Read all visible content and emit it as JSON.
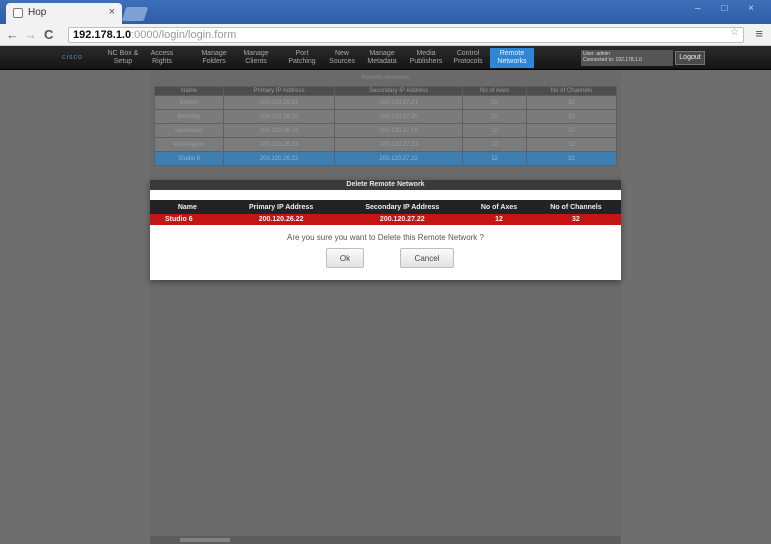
{
  "browser": {
    "tab_title": "Hop",
    "tab_close": "×",
    "window_buttons": "– □ ×",
    "back": "←",
    "forward": "→",
    "reload": "C",
    "url_host": "192.178.1.0",
    "url_path": ":0000/login/login.form",
    "menu_glyph": "≡",
    "bookmark_glyph": "☆"
  },
  "appnav": {
    "logo": "cisco",
    "items": [
      {
        "label": "NC Box &\nSetup"
      },
      {
        "label": "Access\nRights"
      },
      {
        "label": "Manage\nFolders"
      },
      {
        "label": "Manage\nClients"
      },
      {
        "label": "Port\nPatching"
      },
      {
        "label": "New\nSources"
      },
      {
        "label": "Manage\nMetadata"
      },
      {
        "label": "Media\nPublishers"
      },
      {
        "label": "Control\nProtocols"
      },
      {
        "label": "Remote\nNetworks"
      }
    ],
    "active_index": 9,
    "user_info": "User: admin\nConnected to: 192.178.1.0",
    "logout_label": "Logout"
  },
  "background": {
    "title": "Remote Networks",
    "columns": [
      "Name",
      "Primary IP Address",
      "Secondary IP Address",
      "No of Axes",
      "No of Channels"
    ],
    "rows": [
      [
        "Boston",
        "200.120.26.21",
        "200.120.27.21",
        "12",
        "32"
      ],
      [
        "Berkeley",
        "200.120.26.20",
        "200.120.27.20",
        "12",
        "32"
      ],
      [
        "Vancouver",
        "200.120.26.19",
        "200.120.27.19",
        "12",
        "32"
      ],
      [
        "Washington",
        "200.120.26.23",
        "200.120.27.23",
        "12",
        "32"
      ],
      [
        "Studio 6",
        "200.120.26.22",
        "200.120.27.22",
        "12",
        "32"
      ]
    ]
  },
  "dialog": {
    "title": "Delete Remote Network",
    "columns": [
      "Name",
      "Primary IP Address",
      "Secondary IP Address",
      "No of Axes",
      "No of Channels"
    ],
    "row": [
      "Studio 6",
      "200.120.26.22",
      "200.120.27.22",
      "12",
      "32"
    ],
    "question": "Are you sure you want to Delete this Remote Network ?",
    "ok_label": "Ok",
    "cancel_label": "Cancel"
  },
  "colors": {
    "accent": "#2d86d6",
    "danger_row": "#c41414",
    "dialog_header": "#232323"
  }
}
